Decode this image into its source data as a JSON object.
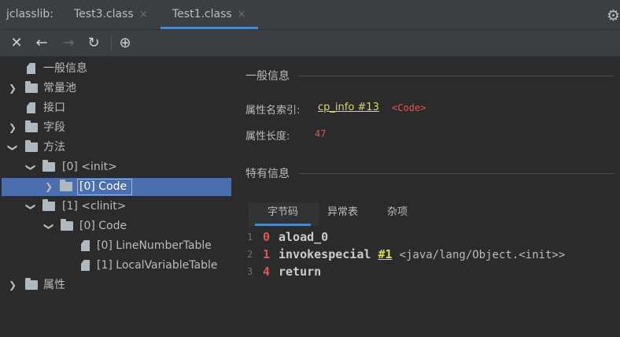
{
  "tabbar": {
    "app_name": "jclasslib:",
    "tabs": [
      {
        "label": "Test3.class",
        "active": false
      },
      {
        "label": "Test1.class",
        "active": true
      }
    ],
    "close_glyph": "×",
    "settings_icon": "gear-icon"
  },
  "toolbar": {
    "buttons": [
      {
        "name": "close-icon",
        "glyph": "✕"
      },
      {
        "name": "back-arrow-icon",
        "glyph": "←"
      },
      {
        "name": "forward-arrow-icon",
        "glyph": "→"
      },
      {
        "name": "refresh-icon",
        "glyph": "↻"
      },
      {
        "name": "web-icon",
        "glyph": "⊕"
      }
    ]
  },
  "tree": {
    "items": [
      {
        "label": "一般信息"
      },
      {
        "label": "常量池"
      },
      {
        "label": "接口"
      },
      {
        "label": "字段"
      },
      {
        "label": "方法"
      },
      {
        "label": "[0] <init>"
      },
      {
        "label": "[0] Code"
      },
      {
        "label": "[1] <clinit>"
      },
      {
        "label": "[0] Code"
      },
      {
        "label": "[0] LineNumberTable"
      },
      {
        "label": "[1] LocalVariableTable"
      },
      {
        "label": "属性"
      }
    ]
  },
  "general": {
    "title": "一般信息",
    "name_index_label": "属性名索引:",
    "name_index_link": "cp_info #13",
    "name_index_value": "<Code>",
    "length_label": "属性长度:",
    "length_value": "47"
  },
  "specific": {
    "title": "特有信息",
    "tabs": [
      "字节码",
      "异常表",
      "杂项"
    ]
  },
  "bytecode": [
    {
      "line": "1",
      "index": "0",
      "op": "aload_0",
      "arg": "",
      "comment": ""
    },
    {
      "line": "2",
      "index": "1",
      "op": "invokespecial",
      "arg": "#1",
      "comment": "<java/lang/Object.<init>>"
    },
    {
      "line": "3",
      "index": "4",
      "op": "return",
      "arg": "",
      "comment": ""
    }
  ],
  "colors": {
    "accent": "#4a88c7",
    "selection": "#4b6eaf",
    "link": "#d9d95b",
    "number": "#e05555"
  }
}
